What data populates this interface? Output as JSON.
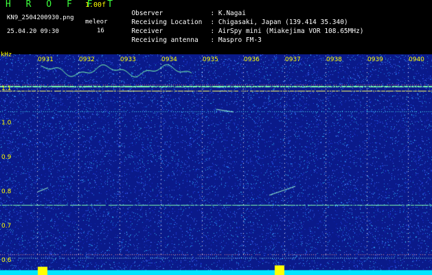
{
  "header": {
    "app_title": "H R O F F T",
    "version": "1.00f",
    "filename": "KN9_2504200930.png",
    "datetime": "25.04.20 09:30",
    "mode_label": "meleor",
    "mode_value": "16"
  },
  "info": [
    {
      "key": "Observer",
      "value": ": K.Nagai"
    },
    {
      "key": "Receiving Location",
      "value": ": Chigasaki, Japan (139.414 35.340)"
    },
    {
      "key": "Receiver",
      "value": ": AirSpy mini (Miakejima VOR 108.65MHz)"
    },
    {
      "key": "Receiving antenna",
      "value": ": Maspro FM-3"
    }
  ],
  "axis": {
    "unit": "kHz",
    "y_ticks": [
      "1.1",
      "1.0",
      "0.9",
      "0.8",
      "0.7",
      "0.6"
    ],
    "x_ticks": [
      "0931",
      "0932",
      "0933",
      "0934",
      "0935",
      "0936",
      "0937",
      "0938",
      "0939",
      "0940"
    ]
  },
  "colors": {
    "background": "#0a1a8a",
    "noise": "#3a6aff",
    "trace": "#7dffb0",
    "baseline": "#00e5ff",
    "marker": "#ffff00"
  }
}
